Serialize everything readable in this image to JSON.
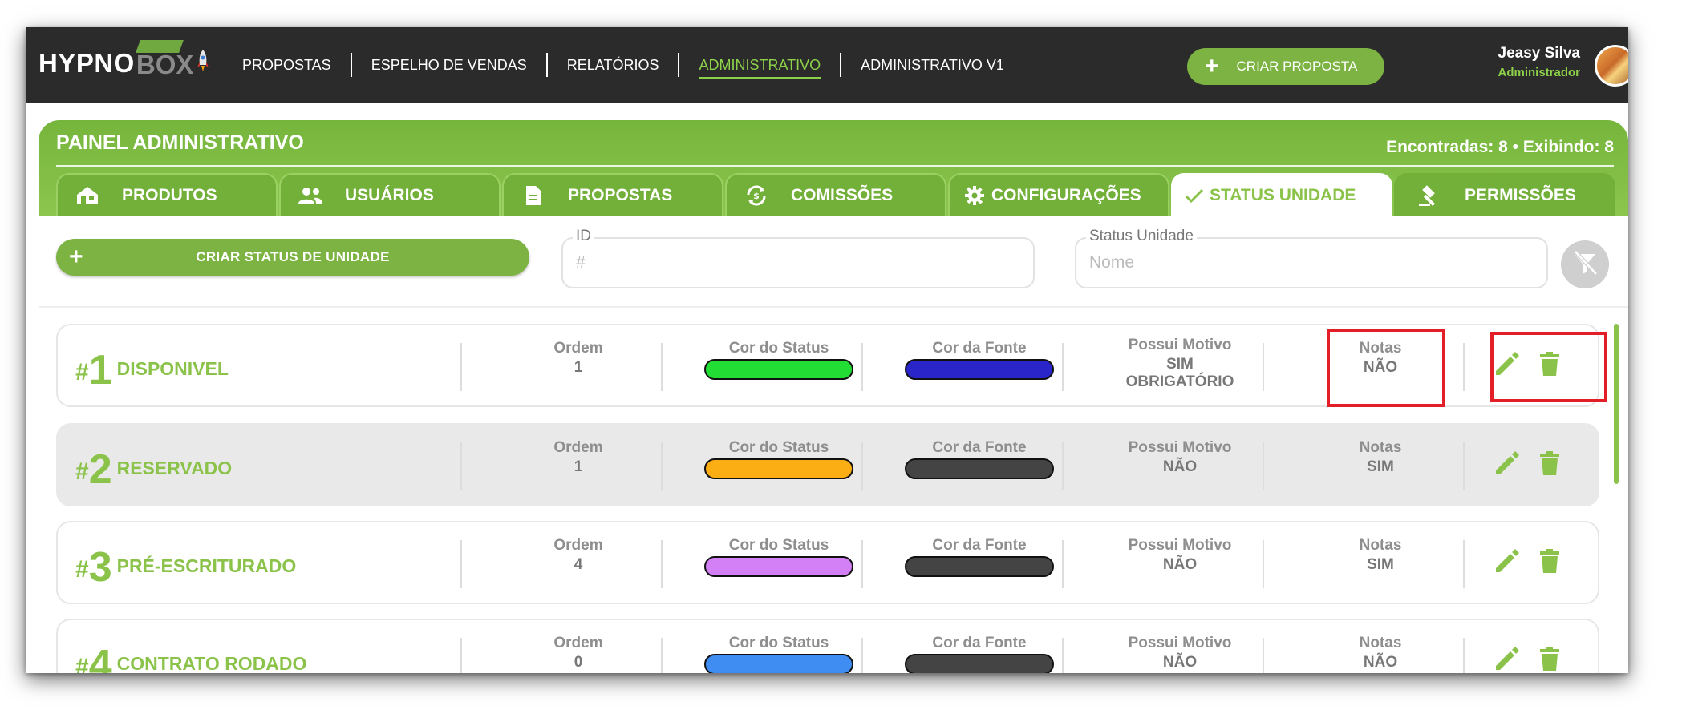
{
  "brand": {
    "hypno": "HYPNO",
    "box": "BOX"
  },
  "nav": [
    {
      "label": "PROPOSTAS"
    },
    {
      "label": "ESPELHO DE VENDAS"
    },
    {
      "label": "RELATÓRIOS"
    },
    {
      "label": "ADMINISTRATIVO"
    },
    {
      "label": "ADMINISTRATIVO V1"
    }
  ],
  "top_action": {
    "plus": "+",
    "label": "CRIAR PROPOSTA"
  },
  "user": {
    "name": "Jeasy Silva",
    "role": "Administrador"
  },
  "panel": {
    "title": "PAINEL ADMINISTRATIVO",
    "count": "Encontradas: 8 • Exibindo: 8"
  },
  "tabs": [
    {
      "label": "PRODUTOS",
      "icon": "store-icon"
    },
    {
      "label": "USUÁRIOS",
      "icon": "users-icon"
    },
    {
      "label": "PROPOSTAS",
      "icon": "document-icon"
    },
    {
      "label": "COMISSÕES",
      "icon": "currency-sync-icon"
    },
    {
      "label": "CONFIGURAÇÕES",
      "icon": "gear-icon"
    },
    {
      "label": "STATUS UNIDADE",
      "icon": "check-icon"
    },
    {
      "label": "PERMISSÕES",
      "icon": "gavel-icon"
    }
  ],
  "filters": {
    "create_plus": "+",
    "create_label": "CRIAR STATUS DE UNIDADE",
    "id_label": "ID",
    "id_placeholder": "#",
    "status_label": "Status Unidade",
    "status_placeholder": "Nome"
  },
  "labels": {
    "ordem": "Ordem",
    "cor_status": "Cor do Status",
    "cor_fonte": "Cor da Fonte",
    "motivo": "Possui Motivo",
    "notas": "Notas",
    "hash": "#"
  },
  "rows": [
    {
      "id": "1",
      "name": "DISPONIVEL",
      "ordem": "1",
      "status_color": "#22dd33",
      "font_color": "#2a25c8",
      "motivo": "SIM",
      "motivo_extra": "OBRIGATÓRIO",
      "notas": "NÃO"
    },
    {
      "id": "2",
      "name": "RESERVADO",
      "ordem": "1",
      "status_color": "#fbad14",
      "font_color": "#444444",
      "motivo": "NÃO",
      "motivo_extra": "",
      "notas": "SIM"
    },
    {
      "id": "3",
      "name": "PRÉ-ESCRITURADO",
      "ordem": "4",
      "status_color": "#d37ff5",
      "font_color": "#444444",
      "motivo": "NÃO",
      "motivo_extra": "",
      "notas": "SIM"
    },
    {
      "id": "4",
      "name": "CONTRATO RODADO",
      "ordem": "0",
      "status_color": "#3f8cf2",
      "font_color": "#444444",
      "motivo": "NÃO",
      "motivo_extra": "",
      "notas": "NÃO"
    }
  ],
  "colors": {
    "brand_green": "#8bc34a",
    "dark_header": "#2b2b2b",
    "highlight_red": "#e41e26"
  }
}
